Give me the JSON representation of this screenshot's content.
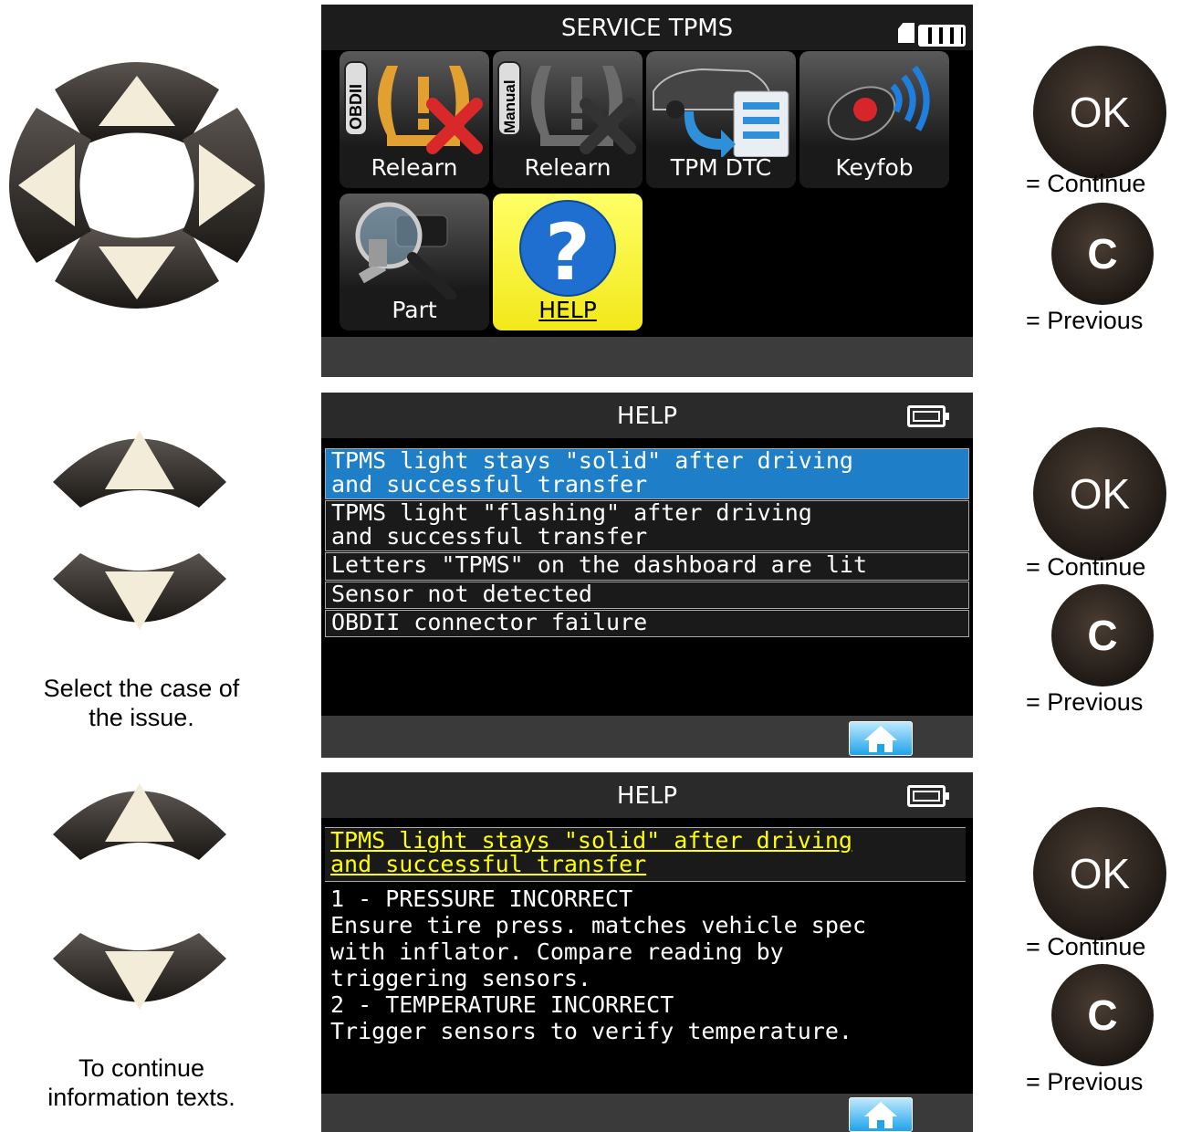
{
  "legends": {
    "ok_label": "OK",
    "c_label": "C",
    "continue": "= Continue",
    "previous": "= Previous"
  },
  "captions": {
    "select_case": "Select the case of\nthe issue.",
    "continue_info": "To continue\ninformation texts."
  },
  "screen1": {
    "title": "SERVICE TPMS",
    "tiles": [
      {
        "label": "Relearn",
        "badge": "OBDII",
        "icon": "tpms-obdii-icon"
      },
      {
        "label": "Relearn",
        "badge": "Manual",
        "icon": "tpms-manual-icon"
      },
      {
        "label": "TPM DTC",
        "icon": "car-dtc-icon"
      },
      {
        "label": "Keyfob",
        "icon": "keyfob-icon"
      },
      {
        "label": "Part",
        "icon": "sensor-magnifier-icon"
      },
      {
        "label": "HELP",
        "icon": "help-icon"
      }
    ]
  },
  "screen2": {
    "title": "HELP",
    "items": [
      "TPMS light stays \"solid\" after driving\nand successful transfer",
      "TPMS light \"flashing\" after driving\nand successful transfer",
      "Letters \"TPMS\" on the dashboard are lit",
      "Sensor not detected",
      "OBDII connector failure"
    ]
  },
  "screen3": {
    "title": "HELP",
    "heading": "TPMS light stays \"solid\" after driving\nand successful transfer",
    "body": "1 - PRESSURE INCORRECT\nEnsure tire press. matches vehicle spec\nwith inflator. Compare reading by\ntriggering sensors.\n2 - TEMPERATURE INCORRECT\nTrigger sensors to verify temperature."
  },
  "colors": {
    "selected_row": "#1e7ec8",
    "selected_tile": "#f2e81a",
    "heading_text": "#ffff00"
  }
}
